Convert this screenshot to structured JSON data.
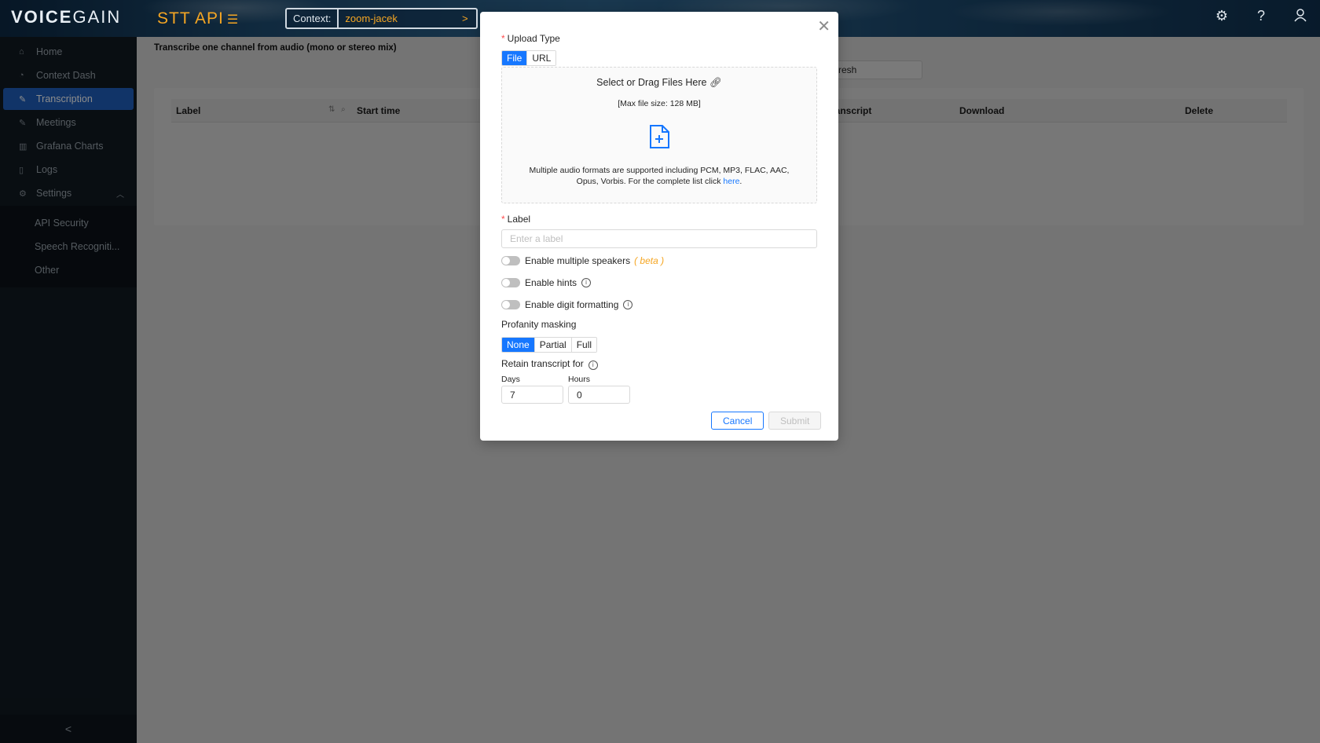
{
  "header": {
    "logo_bold": "VOICE",
    "logo_thin": "GAIN",
    "product": "STT API",
    "context_label": "Context:",
    "context_value": "zoom-jacek",
    "context_arrow": ">"
  },
  "sidebar": {
    "items": [
      {
        "label": "Home",
        "icon": "home-icon"
      },
      {
        "label": "Context Dash",
        "icon": "dashboard-icon"
      },
      {
        "label": "Transcription",
        "icon": "edit-icon"
      },
      {
        "label": "Meetings",
        "icon": "edit-icon"
      },
      {
        "label": "Grafana Charts",
        "icon": "bar-chart-icon"
      },
      {
        "label": "Logs",
        "icon": "file-icon"
      },
      {
        "label": "Settings",
        "icon": "gear-icon"
      }
    ],
    "sub_items": [
      "API Security",
      "Speech Recogniti...",
      "Other"
    ],
    "collapse": "<"
  },
  "main": {
    "description": "Transcribe one channel from audio (mono or stereo mix)",
    "refresh_label": "resh",
    "columns": [
      "Label",
      "Start time",
      "ranscript",
      "Download",
      "Delete"
    ]
  },
  "modal": {
    "upload_type_label": "Upload Type",
    "upload_types": [
      "File",
      "URL"
    ],
    "upload_type_selected": "File",
    "dropzone_title": "Select or Drag Files Here",
    "dropzone_max": "[Max file size: 128 MB]",
    "dropzone_desc": "Multiple audio formats are supported including PCM, MP3, FLAC, AAC, Opus, Vorbis. For the complete list click",
    "dropzone_link": "here",
    "label_label": "Label",
    "label_placeholder": "Enter a label",
    "label_value": "",
    "toggle_speakers": "Enable multiple speakers",
    "beta": "( beta )",
    "toggle_hints": "Enable hints",
    "toggle_digits": "Enable digit formatting",
    "profanity_label": "Profanity masking",
    "profanity_options": [
      "None",
      "Partial",
      "Full"
    ],
    "profanity_selected": "None",
    "retain_label": "Retain transcript for",
    "days_label": "Days",
    "days_value": "7",
    "hours_label": "Hours",
    "hours_value": "0",
    "cancel": "Cancel",
    "submit": "Submit"
  },
  "colors": {
    "accent": "#1677ff",
    "brand_orange": "#f5a623",
    "sidebar_bg": "#111a22",
    "sidebar_active": "#1f5fbd",
    "required": "#ff4d4f"
  }
}
